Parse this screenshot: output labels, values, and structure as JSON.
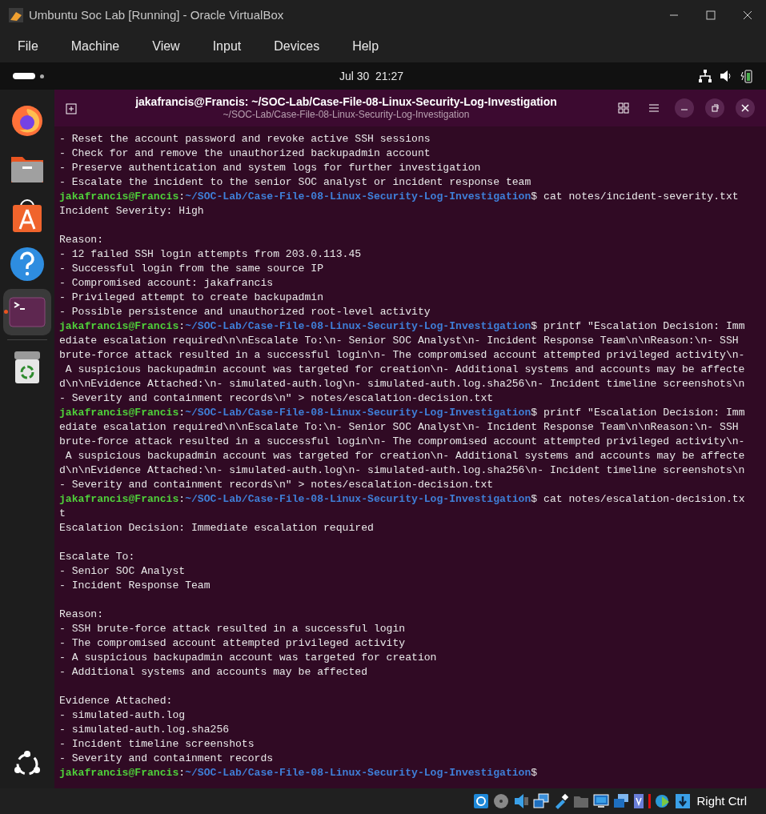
{
  "window": {
    "title": "Umbuntu Soc Lab [Running] - Oracle VirtualBox"
  },
  "menu": [
    "File",
    "Machine",
    "View",
    "Input",
    "Devices",
    "Help"
  ],
  "top_bar": {
    "clock": "Jul 30  21:27"
  },
  "dock": [
    {
      "kind": "browser",
      "running": false
    },
    {
      "kind": "files",
      "running": false
    },
    {
      "kind": "store",
      "running": false
    },
    {
      "kind": "help",
      "running": false
    },
    {
      "kind": "terminal",
      "running": true
    },
    {
      "kind": "trash",
      "running": false
    }
  ],
  "terminal": {
    "title": "jakafrancis@Francis: ~/SOC-Lab/Case-File-08-Linux-Security-Log-Investigation",
    "subtitle": "~/SOC-Lab/Case-File-08-Linux-Security-Log-Investigation",
    "lines": [
      {
        "kind": "output",
        "text": "- Reset the account password and revoke active SSH sessions"
      },
      {
        "kind": "output",
        "text": "- Check for and remove the unauthorized backupadmin account"
      },
      {
        "kind": "output",
        "text": "- Preserve authentication and system logs for further investigation"
      },
      {
        "kind": "output",
        "text": "- Escalate the incident to the senior SOC analyst or incident response team"
      },
      {
        "kind": "prompt",
        "user": "jakafrancis@Francis",
        "separator": ":",
        "path": "~/SOC-Lab/Case-File-08-Linux-Security-Log-Investigation",
        "symbol": "$",
        "command": "cat notes/incident-severity.txt"
      },
      {
        "kind": "output",
        "text": "Incident Severity: High"
      },
      {
        "kind": "blank"
      },
      {
        "kind": "output",
        "text": "Reason:"
      },
      {
        "kind": "output",
        "text": "- 12 failed SSH login attempts from 203.0.113.45"
      },
      {
        "kind": "output",
        "text": "- Successful login from the same source IP"
      },
      {
        "kind": "output",
        "text": "- Compromised account: jakafrancis"
      },
      {
        "kind": "output",
        "text": "- Privileged attempt to create backupadmin"
      },
      {
        "kind": "output",
        "text": "- Possible persistence and unauthorized root-level activity"
      },
      {
        "kind": "prompt",
        "user": "jakafrancis@Francis",
        "separator": ":",
        "path": "~/SOC-Lab/Case-File-08-Linux-Security-Log-Investigation",
        "symbol": "$",
        "command": "printf \"Escalation Decision: Imm"
      },
      {
        "kind": "output",
        "text": "ediate escalation required\\n\\nEscalate To:\\n- Senior SOC Analyst\\n- Incident Response Team\\n\\nReason:\\n- SSH"
      },
      {
        "kind": "output",
        "text": "brute-force attack resulted in a successful login\\n- The compromised account attempted privileged activity\\n-"
      },
      {
        "kind": "output",
        "text": " A suspicious backupadmin account was targeted for creation\\n- Additional systems and accounts may be affecte"
      },
      {
        "kind": "output",
        "text": "d\\n\\nEvidence Attached:\\n- simulated-auth.log\\n- simulated-auth.log.sha256\\n- Incident timeline screenshots\\n"
      },
      {
        "kind": "output",
        "text": "- Severity and containment records\\n\" > notes/escalation-decision.txt"
      },
      {
        "kind": "prompt",
        "user": "jakafrancis@Francis",
        "separator": ":",
        "path": "~/SOC-Lab/Case-File-08-Linux-Security-Log-Investigation",
        "symbol": "$",
        "command": "printf \"Escalation Decision: Imm"
      },
      {
        "kind": "output",
        "text": "ediate escalation required\\n\\nEscalate To:\\n- Senior SOC Analyst\\n- Incident Response Team\\n\\nReason:\\n- SSH"
      },
      {
        "kind": "output",
        "text": "brute-force attack resulted in a successful login\\n- The compromised account attempted privileged activity\\n-"
      },
      {
        "kind": "output",
        "text": " A suspicious backupadmin account was targeted for creation\\n- Additional systems and accounts may be affecte"
      },
      {
        "kind": "output",
        "text": "d\\n\\nEvidence Attached:\\n- simulated-auth.log\\n- simulated-auth.log.sha256\\n- Incident timeline screenshots\\n"
      },
      {
        "kind": "output",
        "text": "- Severity and containment records\\n\" > notes/escalation-decision.txt"
      },
      {
        "kind": "prompt",
        "user": "jakafrancis@Francis",
        "separator": ":",
        "path": "~/SOC-Lab/Case-File-08-Linux-Security-Log-Investigation",
        "symbol": "$",
        "command": "cat notes/escalation-decision.tx"
      },
      {
        "kind": "output",
        "text": "t"
      },
      {
        "kind": "output",
        "text": "Escalation Decision: Immediate escalation required"
      },
      {
        "kind": "blank"
      },
      {
        "kind": "output",
        "text": "Escalate To:"
      },
      {
        "kind": "output",
        "text": "- Senior SOC Analyst"
      },
      {
        "kind": "output",
        "text": "- Incident Response Team"
      },
      {
        "kind": "blank"
      },
      {
        "kind": "output",
        "text": "Reason:"
      },
      {
        "kind": "output",
        "text": "- SSH brute-force attack resulted in a successful login"
      },
      {
        "kind": "output",
        "text": "- The compromised account attempted privileged activity"
      },
      {
        "kind": "output",
        "text": "- A suspicious backupadmin account was targeted for creation"
      },
      {
        "kind": "output",
        "text": "- Additional systems and accounts may be affected"
      },
      {
        "kind": "blank"
      },
      {
        "kind": "output",
        "text": "Evidence Attached:"
      },
      {
        "kind": "output",
        "text": "- simulated-auth.log"
      },
      {
        "kind": "output",
        "text": "- simulated-auth.log.sha256"
      },
      {
        "kind": "output",
        "text": "- Incident timeline screenshots"
      },
      {
        "kind": "output",
        "text": "- Severity and containment records"
      },
      {
        "kind": "prompt",
        "user": "jakafrancis@Francis",
        "separator": ":",
        "path": "~/SOC-Lab/Case-File-08-Linux-Security-Log-Investigation",
        "symbol": "$"
      }
    ]
  },
  "status_bar": {
    "host_key": "Right Ctrl"
  }
}
